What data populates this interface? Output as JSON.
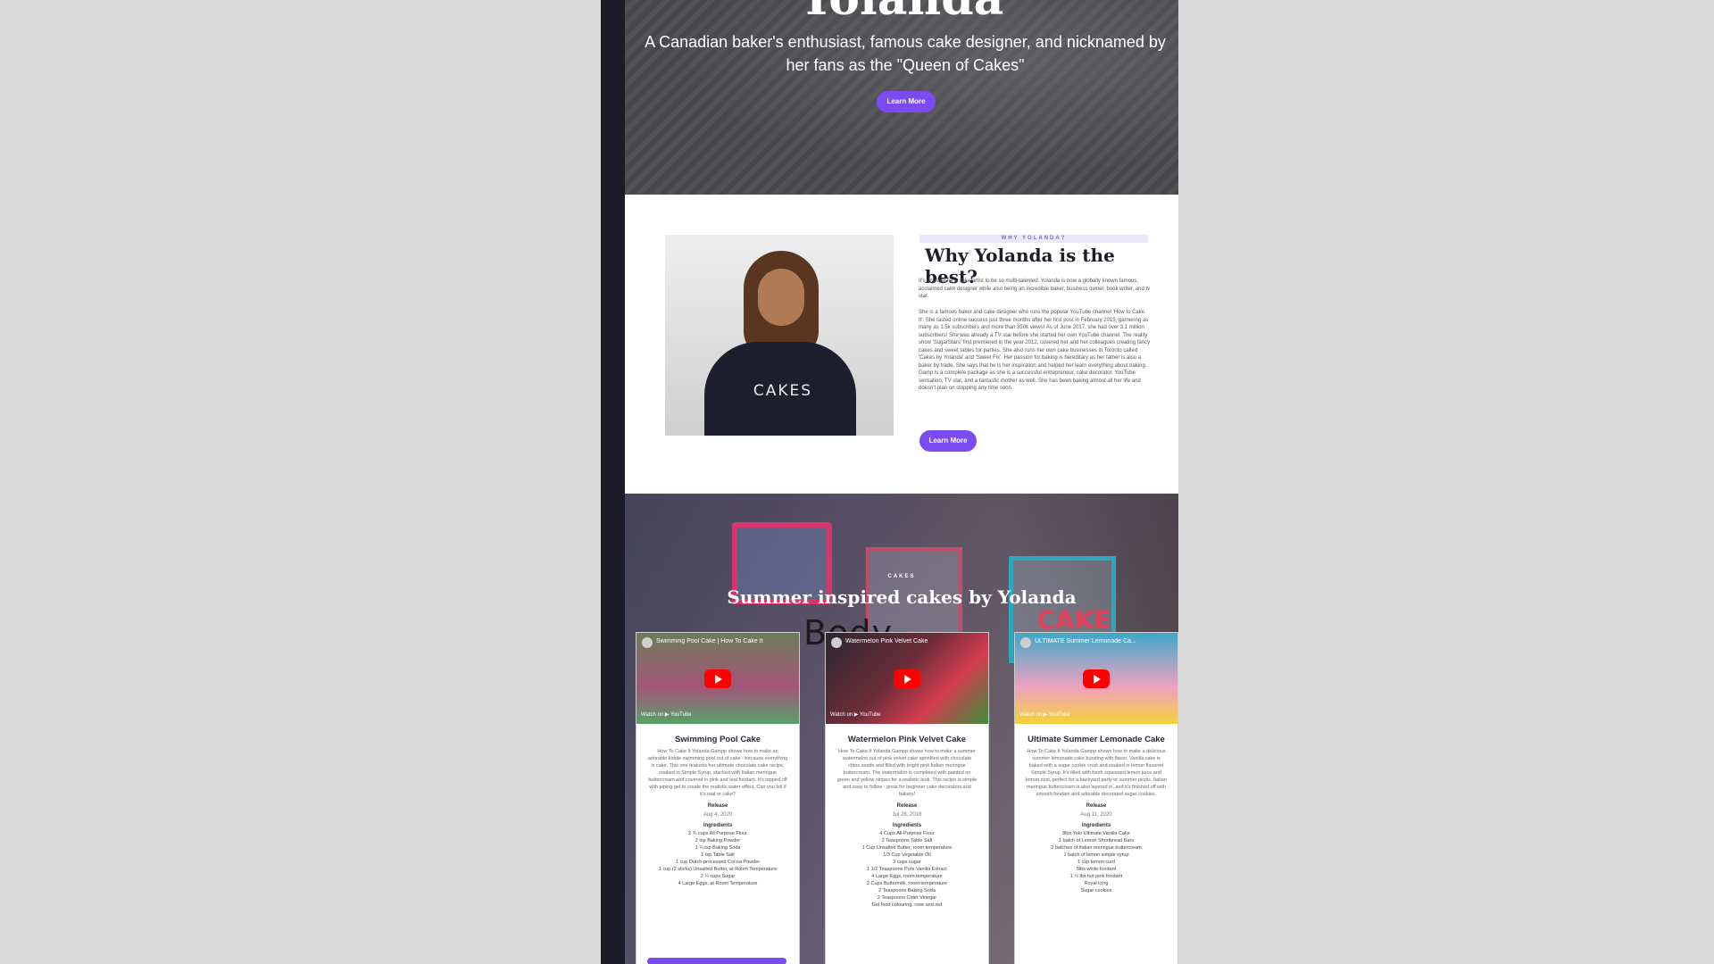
{
  "colors": {
    "accent": "#7b4af0",
    "sidebar": "#1b1a28",
    "background": "#d9d9d9"
  },
  "hero": {
    "title": "Yolanda",
    "subtitle": "A Canadian baker's enthusiast, famous cake designer, and nicknamed by her fans as the \"Queen of Cakes\"",
    "button_label": "Learn More"
  },
  "why": {
    "eyebrow": "WHY YOLANDA?",
    "title": "Why Yolanda is the best?",
    "paragraph_1": "It's unusual for a cake artist to be so multi-talented. Yolanda is now a globally known famous, acclaimed cake designer while also being an incredible baker, business owner, book writer, and tv star.",
    "paragraph_2": "She is a famous baker and cake designer who runs the popular YouTube channel 'How to Cake It'. She tasted online success just three months after her first post in February 2015, garnering as many as 1.5k subscribers and more than 350k views! As of June 2017, she had over 3.1 million subscribers! She was already a TV star before she started her own YouTube channel. The reality show 'SugarStars' first premiered in the year 2012, covered her and her colleagues creating fancy cakes and sweet tables for parties. She also runs her own cake businesses in Toronto called 'Cakes by Yolanda' and 'Sweet Fix'. Her passion for baking is hereditary as her father is also a baker by trade. She says that he is her inspiration and helped her learn everything about baking. Gamp is a complete package as she is a successful entrepreneur, cake decorator, YouTube sensation, TV star, and a fantastic mother as well. She has been baking almost all her life and doesn't plan on stopping any time soon.",
    "button_label": "Learn More",
    "photo_shirt_text": "CAKES"
  },
  "cakes": {
    "eyebrow": "CAKES",
    "title": "Summer inspired cakes by Yolanda",
    "overlay_label": "Body",
    "sign_text": "CAKE",
    "cards": [
      {
        "thumb_title": "Swimming Pool Cake | How To Cake It",
        "watch_on": "Watch on ▶ YouTube",
        "name": "Swimming Pool Cake",
        "description": "How To Cake It Yolanda Gampp shows how to make an adorable kiddie swimming pool out of cake - because everything is cake. This one features her ultimate chocolate cake recipe, soaked in Simple Syrup, stacked with Italian meringue buttercream and covered in pink and teal fondant. It's topped off with piping gel to create the realistic water effect. Can you tell if it's real or cake?",
        "release_label": "Release",
        "release_date": "Aug 4, 2020",
        "ingredients_label": "Ingredients",
        "ingredients": [
          "2 ¾ cups All Purpose Flour",
          "2 tsp Baking Powder",
          "1 ¼ tsp Baking Soda",
          "1 tsp Table Salt",
          "1 cup Dutch-processed Cocoa Powder",
          "1 cup (2 sticks) Unsalted Butter, at Room Temperature",
          "2 ¼ cups Sugar",
          "4 Large Eggs, at Room Temperature"
        ]
      },
      {
        "thumb_title": "Watermelon Pink Velvet Cake",
        "watch_on": "Watch on ▶ YouTube",
        "name": "Watermelon Pink Velvet Cake",
        "description": "How To Cake It Yolanda Gampp shows how to make a summer watermelon out of pink velvet cake sprinkled with chocolate chips seeds and filled with bright pink Italian meringue buttercream. The watermelon is completed with painted on green and yellow stripes for a realistic look. This recipe is simple and easy to follow - great for beginner cake decorators and bakers!",
        "release_label": "Release",
        "release_date": "Jul 28, 2018",
        "ingredients_label": "Ingredients",
        "ingredients": [
          "4 Cups All-Purpose Flour",
          "2 Teaspoons Table Salt",
          "1 Cup Unsalted Butter, room temperature",
          "1/3 Cup Vegetable Oil",
          "3 cups sugar",
          "1 1/2 Teaspoons Pure Vanilla Extract",
          "4 Large Eggs, room temperature",
          "2 Cups Buttermilk, room temperature",
          "2 Teaspoons Baking Soda",
          "2 Teaspoons Cider Vinegar",
          "Gel food colouring: rose and red"
        ]
      },
      {
        "thumb_title": "ULTIMATE Summer Lemonade Ca...",
        "watch_on": "Watch on ▶ YouTube",
        "name": "Ultimate Summer Lemonade Cake",
        "description": "How To Cake It Yolanda Gampp shows how to make a delicious summer lemonade cake bursting with flavor. Vanilla cake is baked with a sugar cookie crust and soaked in lemon flavored Simple Syrup. It's filled with fresh squeezed lemon juice and lemon zest, perfect for a backyard party or summer picnic. Italian meringue buttercream is also layered in, and it's finished off with smooth fondant and adorable decorated sugar cookies.",
        "release_label": "Release",
        "release_date": "Aug 11, 2020",
        "ingredients_label": "Ingredients",
        "ingredients": [
          "8lbs Yolo Ultimate Vanilla Cake",
          "1 batch of Lemon Shortbread Bars",
          "2 batches of Italian meringue buttercream",
          "1 batch of lemon simple syrup",
          "1 cup lemon curd",
          "5lbs white fondant",
          "1 ½ lbs hot pink fondant",
          "Royal icing",
          "Sugar cookies"
        ]
      }
    ]
  }
}
